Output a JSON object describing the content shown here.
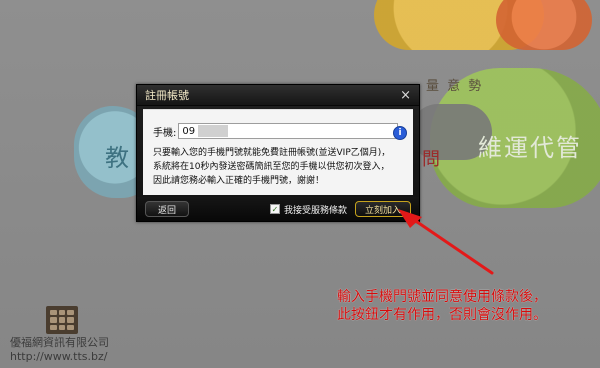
{
  "background": {
    "left_char": "教",
    "right_title": "維運代管",
    "right_col_text": "量\n意\n勢",
    "right_red_text": "問"
  },
  "dialog": {
    "title": "註冊帳號",
    "close_label": "×",
    "phone_label": "手機:",
    "phone_value": "09",
    "info_icon_text": "i",
    "message": "只要輸入您的手機門號就能免費註冊帳號(並送VIP乙個月)，\n系統將在10秒內發送密碼簡訊至您的手機以供您初次登入，\n因此請您務必輸入正確的手機門號，謝謝！",
    "back_button": "返回",
    "terms_label": "我接受服務條款",
    "join_button": "立刻加入"
  },
  "annotation": {
    "text": "輸入手機門號並同意使用條款後，\n此按鈕才有作用，否則會沒作用。",
    "color": "#d40b0b"
  },
  "company": {
    "name": "優福網資訊有限公司",
    "url": "http://www.tts.bz/"
  },
  "icons": {
    "info": "info-icon",
    "checkbox": "checkbox-icon",
    "arrow": "arrow-icon",
    "logo": "logo-icon"
  }
}
